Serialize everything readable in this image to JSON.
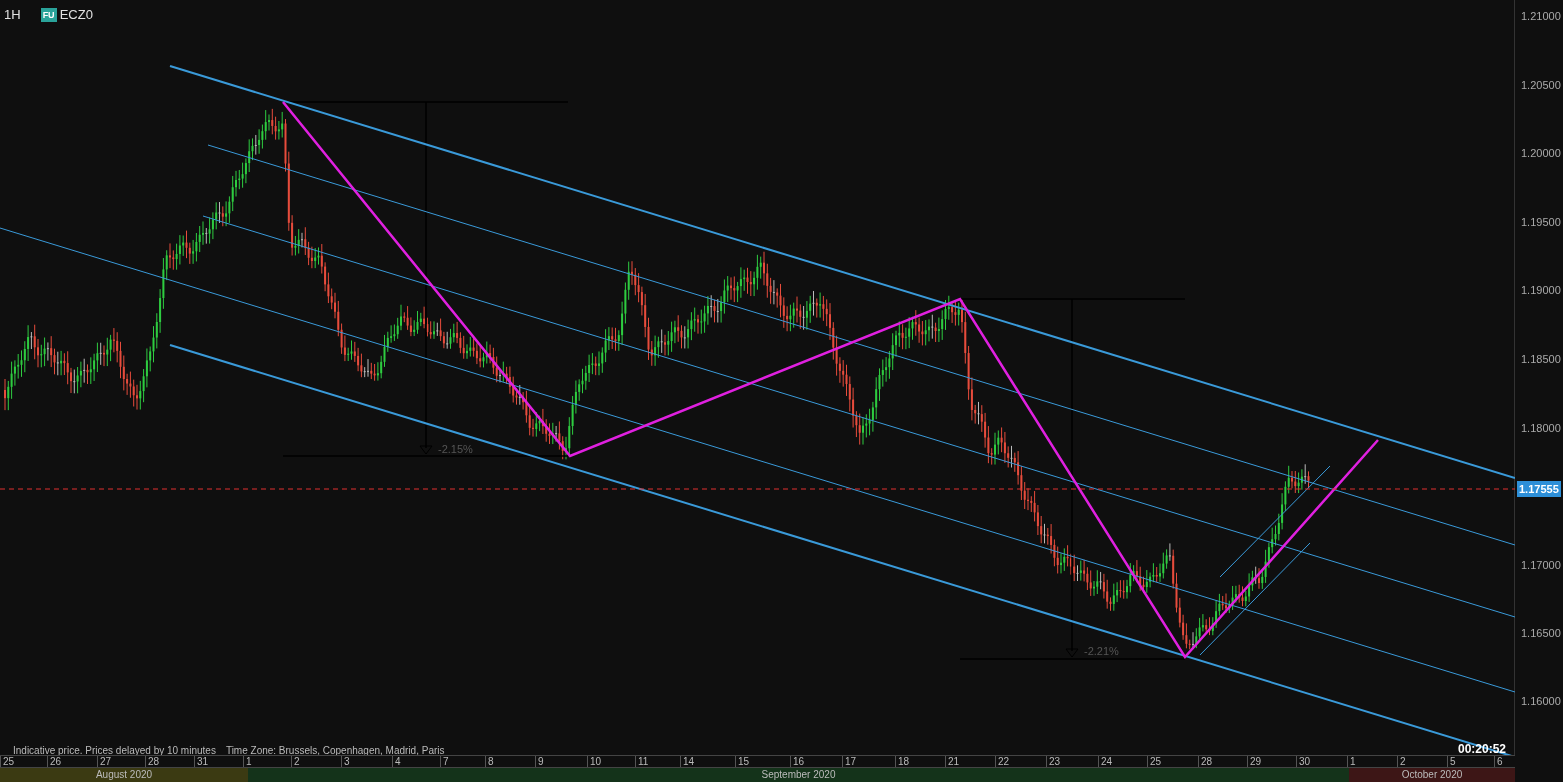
{
  "header": {
    "interval": "1H",
    "badge": "FU",
    "symbol": "ECZ0"
  },
  "price_axis": {
    "labels": [
      "1.21000",
      "1.20500",
      "1.20000",
      "1.19500",
      "1.19000",
      "1.18500",
      "1.18000",
      "1.17000",
      "1.16500",
      "1.16000"
    ],
    "current_price": "1.17555"
  },
  "measurements": [
    {
      "label": "-2.15%"
    },
    {
      "label": "-2.21%"
    }
  ],
  "footer": {
    "note": "Indicative price. Prices delayed by 10 minutes",
    "timezone": "Time Zone: Brussels, Copenhagen, Madrid, Paris"
  },
  "countdown": "00:20:52",
  "time_axis": {
    "ticks": [
      "25",
      "26",
      "27",
      "28",
      "31",
      "1",
      "2",
      "3",
      "4",
      "7",
      "8",
      "9",
      "10",
      "11",
      "14",
      "15",
      "16",
      "17",
      "18",
      "21",
      "22",
      "23",
      "24",
      "25",
      "28",
      "29",
      "30",
      "1",
      "2",
      "5",
      "6"
    ],
    "months": [
      {
        "label": "August 2020",
        "color": "#3b3a12"
      },
      {
        "label": "September 2020",
        "color": "#14331a"
      },
      {
        "label": "October 2020",
        "color": "#3d1616"
      }
    ]
  }
}
